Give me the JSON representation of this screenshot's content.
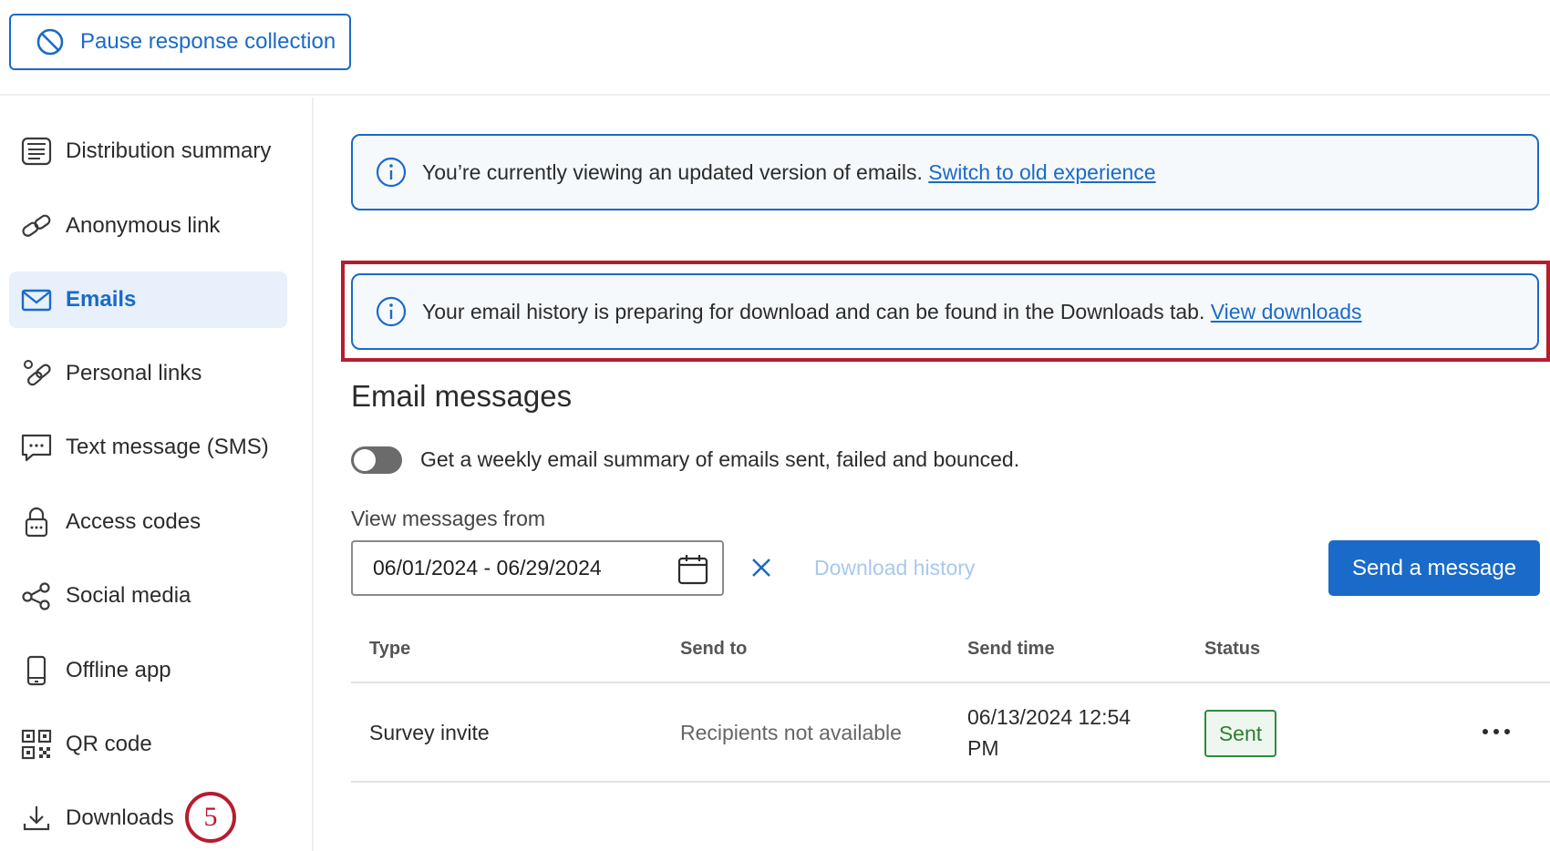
{
  "toolbar": {
    "pause_label": "Pause response collection"
  },
  "sidebar": {
    "items": [
      {
        "label": "Distribution summary",
        "icon": "distribution-summary-icon"
      },
      {
        "label": "Anonymous link",
        "icon": "link-icon"
      },
      {
        "label": "Emails",
        "icon": "envelope-icon",
        "active": true
      },
      {
        "label": "Personal links",
        "icon": "personal-link-icon"
      },
      {
        "label": "Text message (SMS)",
        "icon": "sms-icon"
      },
      {
        "label": "Access codes",
        "icon": "lock-icon"
      },
      {
        "label": "Social media",
        "icon": "share-icon"
      },
      {
        "label": "Offline app",
        "icon": "mobile-icon"
      },
      {
        "label": "QR code",
        "icon": "qr-code-icon"
      },
      {
        "label": "Downloads",
        "icon": "download-icon"
      }
    ],
    "step_badge": "5"
  },
  "banners": {
    "updated": {
      "text": "You’re currently viewing an updated version of emails.",
      "link": "Switch to old experience"
    },
    "download": {
      "text": "Your email history is preparing for download and can be found in the Downloads tab.",
      "link": "View downloads"
    }
  },
  "main": {
    "title": "Email messages",
    "toggle_label": "Get a weekly email summary of emails sent, failed and bounced.",
    "toggle_on": false,
    "filter_label": "View messages from",
    "date_range": "06/01/2024 - 06/29/2024",
    "download_history": "Download history",
    "send_message": "Send a message"
  },
  "table": {
    "headers": {
      "type": "Type",
      "send_to": "Send to",
      "send_time": "Send time",
      "status": "Status"
    },
    "rows": [
      {
        "type": "Survey invite",
        "send_to": "Recipients not available",
        "send_time_line1": "06/13/2024 12:54",
        "send_time_line2": "PM",
        "status": "Sent"
      }
    ]
  },
  "colors": {
    "accent": "#1a6ac9",
    "highlight": "#b51d2e",
    "success": "#2e7d32"
  }
}
